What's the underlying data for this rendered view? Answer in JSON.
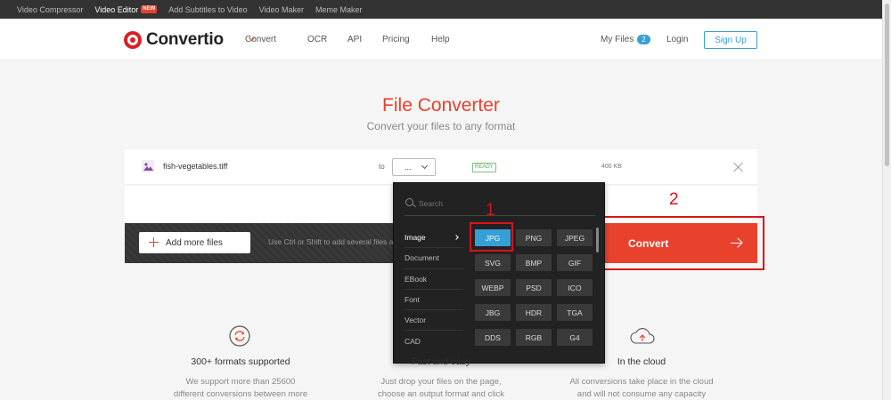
{
  "topbar": {
    "links": [
      {
        "label": "Video Compressor"
      },
      {
        "label": "Video Editor",
        "badge": "NEW",
        "active": true
      },
      {
        "label": "Add Subtitles to Video"
      },
      {
        "label": "Video Maker"
      },
      {
        "label": "Meme Maker"
      }
    ]
  },
  "header": {
    "logo_text": "Convertio",
    "nav": {
      "convert": "Convert",
      "ocr": "OCR",
      "api": "API",
      "pricing": "Pricing",
      "help": "Help"
    },
    "my_files_label": "My Files",
    "my_files_count": "2",
    "login": "Login",
    "signup": "Sign Up"
  },
  "hero": {
    "title": "File Converter",
    "subtitle": "Convert your files to any format"
  },
  "file": {
    "name": "fish-vegetables.tiff",
    "to_label": "to",
    "format_value": "...",
    "status": "READY",
    "size": "400 KB"
  },
  "actions": {
    "add_more": "Add more files",
    "hint": "Use Ctrl or Shift to add several files at once",
    "convert": "Convert"
  },
  "dropdown": {
    "search_placeholder": "Search",
    "categories": [
      "Image",
      "Document",
      "EBook",
      "Font",
      "Vector",
      "CAD"
    ],
    "active_category": "Image",
    "formats": [
      [
        "JPG",
        "PNG",
        "JPEG"
      ],
      [
        "SVG",
        "BMP",
        "GIF"
      ],
      [
        "WEBP",
        "PSD",
        "ICO"
      ],
      [
        "JBG",
        "HDR",
        "TGA"
      ],
      [
        "DDS",
        "RGB",
        "G4"
      ]
    ],
    "selected_format": "JPG"
  },
  "annotations": [
    "1",
    "2"
  ],
  "features": [
    {
      "title": "300+ formats supported",
      "desc": [
        "We support more than 25600",
        "different conversions between more"
      ]
    },
    {
      "title": "Fast and easy",
      "desc": [
        "Just drop your files on the page,",
        "choose an output format and click"
      ]
    },
    {
      "title": "In the cloud",
      "desc": [
        "All conversions take place in the cloud",
        "and will not consume any capacity"
      ]
    }
  ],
  "colors": {
    "brand_red": "#e8412c",
    "accent_blue": "#36a0d6",
    "annotation_red": "#d8151b",
    "dropdown_bg": "#222222"
  }
}
